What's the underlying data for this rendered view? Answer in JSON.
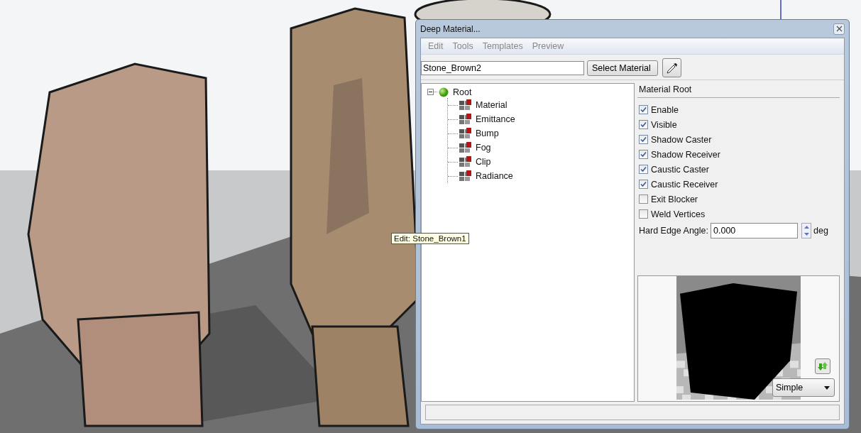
{
  "tooltip": "Edit: Stone_Brown1",
  "window": {
    "title": "Deep Material..."
  },
  "menu": [
    "Edit",
    "Tools",
    "Templates",
    "Preview"
  ],
  "material_name": {
    "value": "Stone_Brown2"
  },
  "select_button": "Select Material",
  "tree": {
    "label": "Root",
    "expanded": true,
    "children": [
      {
        "label": "Material"
      },
      {
        "label": "Emittance"
      },
      {
        "label": "Bump"
      },
      {
        "label": "Fog"
      },
      {
        "label": "Clip"
      },
      {
        "label": "Radiance"
      }
    ]
  },
  "panel": {
    "title": "Material Root",
    "options": [
      {
        "label": "Enable",
        "checked": true
      },
      {
        "label": "Visible",
        "checked": true
      },
      {
        "label": "Shadow Caster",
        "checked": true
      },
      {
        "label": "Shadow Receiver",
        "checked": true
      },
      {
        "label": "Caustic Caster",
        "checked": true
      },
      {
        "label": "Caustic Receiver",
        "checked": true
      },
      {
        "label": "Exit Blocker",
        "checked": false
      },
      {
        "label": "Weld Vertices",
        "checked": false
      }
    ],
    "hard_edge_angle": {
      "label": "Hard Edge Angle:",
      "value": "0.000",
      "unit": "deg"
    }
  },
  "preview": {
    "kind": "picture",
    "mode": "Simple"
  }
}
